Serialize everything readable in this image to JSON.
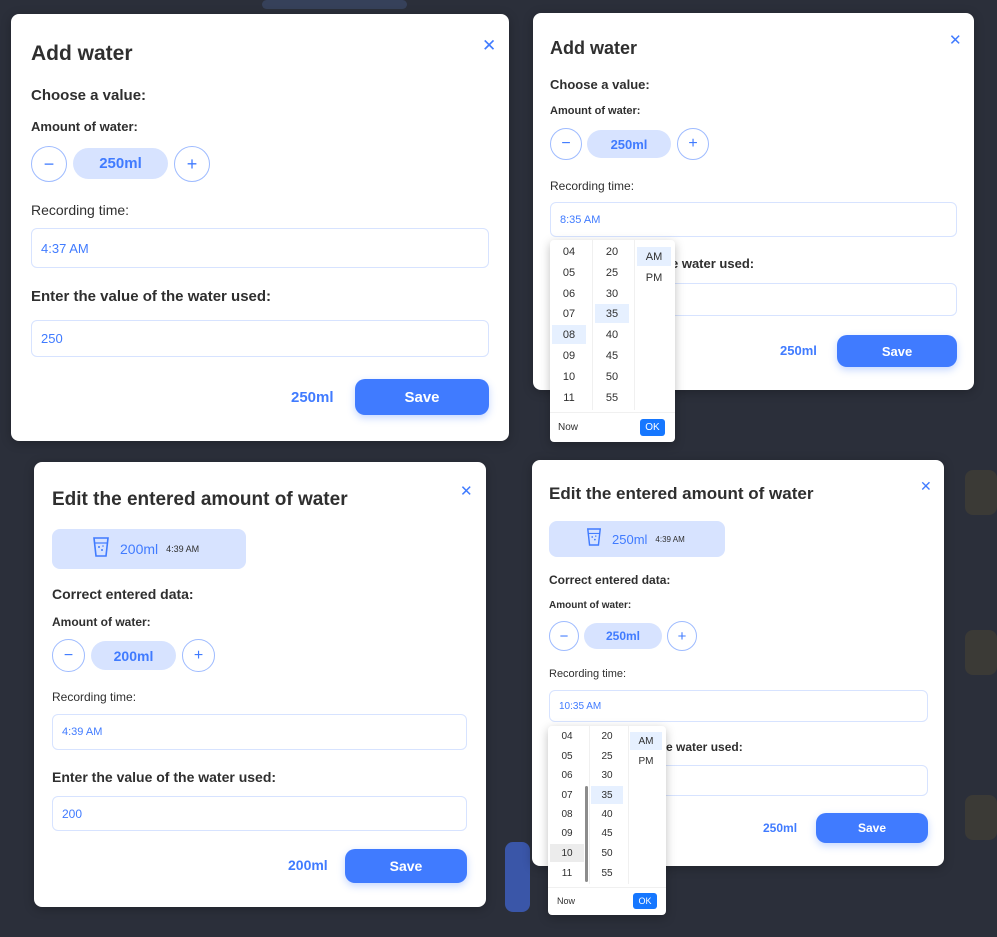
{
  "add_modal": {
    "title": "Add water",
    "choose_label": "Choose a value:",
    "amount_label": "Amount of water:",
    "minus": "−",
    "plus": "+",
    "amount_value": "250ml",
    "recording_label": "Recording time:",
    "time_value": "4:37 AM",
    "enter_label": "Enter the value of the water used:",
    "enter_value": "250",
    "total": "250ml",
    "save_label": "Save",
    "close": "✕"
  },
  "add_modal_picker": {
    "title": "Add water",
    "choose_label": "Choose a value:",
    "amount_label": "Amount of water:",
    "minus": "−",
    "plus": "+",
    "amount_value": "250ml",
    "recording_label": "Recording time:",
    "time_value": "8:35 AM",
    "enter_label_partial": "e water used:",
    "total": "250ml",
    "save_label": "Save",
    "close": "✕",
    "picker": {
      "hours": [
        "04",
        "05",
        "06",
        "07",
        "08",
        "09",
        "10",
        "11"
      ],
      "minutes": [
        "20",
        "25",
        "30",
        "35",
        "40",
        "45",
        "50",
        "55"
      ],
      "meridiem": [
        "AM",
        "PM"
      ],
      "now_label": "Now",
      "ok_label": "OK"
    }
  },
  "edit_modal": {
    "title": "Edit the entered amount of water",
    "entry_amount": "200ml",
    "entry_time": "4:39 AM",
    "correct_label": "Correct entered data:",
    "amount_label": "Amount of water:",
    "minus": "−",
    "plus": "+",
    "amount_value": "200ml",
    "recording_label": "Recording time:",
    "time_value": "4:39 AM",
    "enter_label": "Enter the value of the water used:",
    "enter_value": "200",
    "total": "200ml",
    "save_label": "Save",
    "close": "✕"
  },
  "edit_modal_picker": {
    "title": "Edit the entered amount of water",
    "entry_amount": "250ml",
    "entry_time": "4:39 AM",
    "correct_label": "Correct entered data:",
    "amount_label": "Amount of water:",
    "minus": "−",
    "plus": "+",
    "amount_value": "250ml",
    "recording_label": "Recording time:",
    "time_value": "10:35 AM",
    "enter_label_partial": "e water used:",
    "total": "250ml",
    "save_label": "Save",
    "close": "✕",
    "picker": {
      "hours": [
        "04",
        "05",
        "06",
        "07",
        "08",
        "09",
        "10",
        "11"
      ],
      "minutes": [
        "20",
        "25",
        "30",
        "35",
        "40",
        "45",
        "50",
        "55"
      ],
      "meridiem": [
        "AM",
        "PM"
      ],
      "now_label": "Now",
      "ok_label": "OK"
    }
  },
  "colors": {
    "accent": "#407bff",
    "accent_light": "#d7e3ff",
    "picker_ok": "#1677ff",
    "text": "#2f2f2f",
    "backdrop": "#2b2f3a"
  }
}
